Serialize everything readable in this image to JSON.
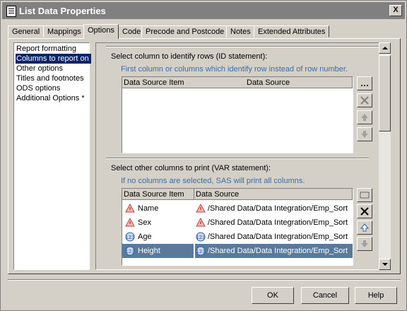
{
  "window": {
    "title": "List Data Properties",
    "close_label": "X"
  },
  "tabs": [
    {
      "label": "General"
    },
    {
      "label": "Mappings"
    },
    {
      "label": "Options",
      "active": true
    },
    {
      "label": "Code"
    },
    {
      "label": "Precode and Postcode"
    },
    {
      "label": "Notes"
    },
    {
      "label": "Extended Attributes"
    }
  ],
  "options_list": [
    {
      "label": "Report formatting"
    },
    {
      "label": "Columns to report on",
      "selected": true
    },
    {
      "label": "Other options"
    },
    {
      "label": "Titles and footnotes"
    },
    {
      "label": "ODS options"
    },
    {
      "label": "Additional Options *"
    }
  ],
  "id_section": {
    "label": "Select column to identify rows (ID statement):",
    "hint": "First column or columns which identify row instead of row number.",
    "columns": [
      "Data Source Item",
      "Data Source"
    ],
    "rows": [],
    "browse_label": "..."
  },
  "var_section": {
    "label": "Select other columns to print (VAR statement):",
    "hint": "If no columns are selected, SAS will print all columns.",
    "columns": [
      "Data Source Item",
      "Data Source"
    ],
    "rows": [
      {
        "item": "Name",
        "source": "/Shared Data/Data Integration/Emp_Sort",
        "type": "char"
      },
      {
        "item": "Sex",
        "source": "/Shared Data/Data Integration/Emp_Sort",
        "type": "char"
      },
      {
        "item": "Age",
        "source": "/Shared Data/Data Integration/Emp_Sort",
        "type": "num"
      },
      {
        "item": "Height",
        "source": "/Shared Data/Data Integration/Emp_Sort",
        "type": "num",
        "selected": true
      }
    ],
    "browse_label": "..."
  },
  "footer": {
    "ok_label": "OK",
    "cancel_label": "Cancel",
    "help_label": "Help"
  },
  "colors": {
    "title_bar": "#808080",
    "selection": "#0a246a",
    "row_selection": "#5a7a9c",
    "hint_text": "#3b6ea5",
    "face": "#d4d0c8"
  },
  "icons": {
    "char_column": "warning-triangle-icon",
    "num_column": "numeric-circle-icon"
  }
}
